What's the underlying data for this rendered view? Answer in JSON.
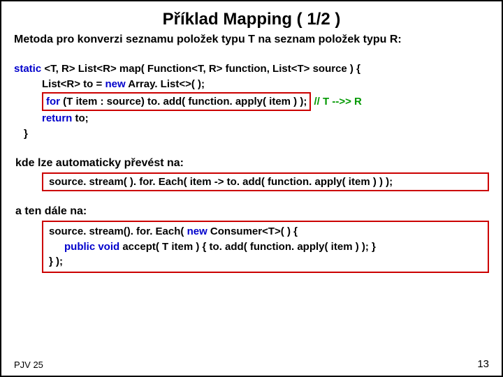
{
  "title": "Příklad  Mapping   ( 1/2 )",
  "subtitle": "Metoda pro konverzi seznamu položek typu T na seznam položek typu R:",
  "code1": {
    "l1a": "static",
    "l1b": " <T, R> List<R> map( Function<T, R> function, List<T> source ) {",
    "l2": "List<R> to = ",
    "l2new": "new",
    "l2b": " Array. List<>( );",
    "l3for": "for",
    "l3mid": " (T item : source)  to. add(  function. apply( item ) ); ",
    "l3comment": " // T -->> R",
    "l4ret": "return",
    "l4b": " to;",
    "l5": "}"
  },
  "label2": "kde lze automaticky převést na:",
  "block2": "source. stream( ). for. Each( item -> to. add(  function. apply( item ) ) );",
  "label3": "a ten dále na:",
  "block3": {
    "l1a": "source. stream(). for. Each( ",
    "l1new": "new",
    "l1b": " Consumer<T>( ) {",
    "l2a": "public void",
    "l2b": " accept( T item ) { to. add(  function. apply( item ) ); }",
    "l3": "} );"
  },
  "footer_left": "PJV 25",
  "footer_right": "13"
}
